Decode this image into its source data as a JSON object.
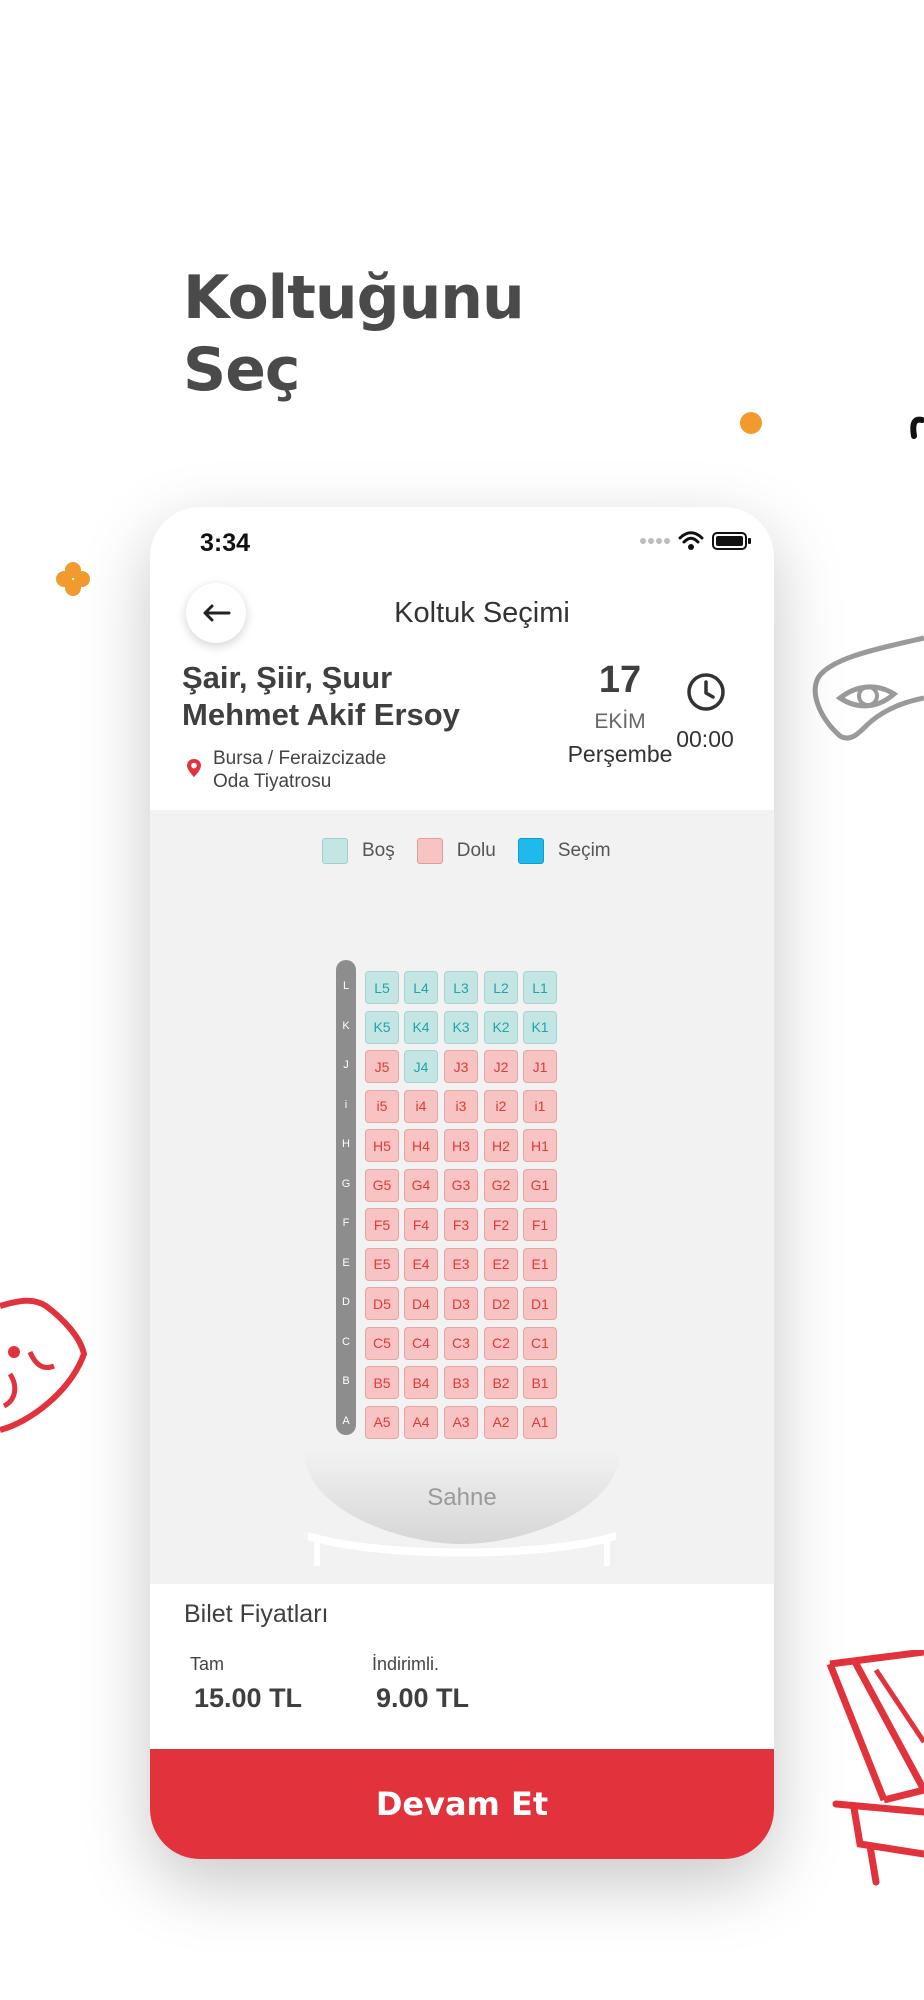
{
  "headline": {
    "line1": "Koltuğunu",
    "line2": "Seç"
  },
  "colors": {
    "accent": "#e2323b",
    "free": "#c3e6e5",
    "taken": "#f7c3c3",
    "selected": "#1fb9ec",
    "decor_orange": "#f39a2f"
  },
  "status_bar": {
    "time": "3:34",
    "icons": [
      "signal-dots-icon",
      "wifi-icon",
      "battery-icon"
    ]
  },
  "nav": {
    "title": "Koltuk Seçimi",
    "back_icon": "arrow-left-icon"
  },
  "event": {
    "title_line1": "Şair, Şiir, Şuur",
    "title_line2": "Mehmet Akif Ersoy",
    "location_line1": "Bursa / Feraizcizade",
    "location_line2": "Oda Tiyatrosu",
    "date_day": "17",
    "date_month": "EKİM",
    "date_weekday": "Perşembe",
    "time": "00:00"
  },
  "legend": [
    {
      "label": "Boş",
      "color": "#c3e6e5"
    },
    {
      "label": "Dolu",
      "color": "#f7c3c3"
    },
    {
      "label": "Seçim",
      "color": "#1fb9ec"
    }
  ],
  "seat_rows": [
    {
      "row": "L",
      "seats": [
        [
          "L5",
          "free"
        ],
        [
          "L4",
          "free"
        ],
        [
          "L3",
          "free"
        ],
        [
          "L2",
          "free"
        ],
        [
          "L1",
          "free"
        ]
      ]
    },
    {
      "row": "K",
      "seats": [
        [
          "K5",
          "free"
        ],
        [
          "K4",
          "free"
        ],
        [
          "K3",
          "free"
        ],
        [
          "K2",
          "free"
        ],
        [
          "K1",
          "free"
        ]
      ]
    },
    {
      "row": "J",
      "seats": [
        [
          "J5",
          "taken"
        ],
        [
          "J4",
          "free"
        ],
        [
          "J3",
          "taken"
        ],
        [
          "J2",
          "taken"
        ],
        [
          "J1",
          "taken"
        ]
      ]
    },
    {
      "row": "i",
      "seats": [
        [
          "i5",
          "taken"
        ],
        [
          "i4",
          "taken"
        ],
        [
          "i3",
          "taken"
        ],
        [
          "i2",
          "taken"
        ],
        [
          "i1",
          "taken"
        ]
      ]
    },
    {
      "row": "H",
      "seats": [
        [
          "H5",
          "taken"
        ],
        [
          "H4",
          "taken"
        ],
        [
          "H3",
          "taken"
        ],
        [
          "H2",
          "taken"
        ],
        [
          "H1",
          "taken"
        ]
      ]
    },
    {
      "row": "G",
      "seats": [
        [
          "G5",
          "taken"
        ],
        [
          "G4",
          "taken"
        ],
        [
          "G3",
          "taken"
        ],
        [
          "G2",
          "taken"
        ],
        [
          "G1",
          "taken"
        ]
      ]
    },
    {
      "row": "F",
      "seats": [
        [
          "F5",
          "taken"
        ],
        [
          "F4",
          "taken"
        ],
        [
          "F3",
          "taken"
        ],
        [
          "F2",
          "taken"
        ],
        [
          "F1",
          "taken"
        ]
      ]
    },
    {
      "row": "E",
      "seats": [
        [
          "E5",
          "taken"
        ],
        [
          "E4",
          "taken"
        ],
        [
          "E3",
          "taken"
        ],
        [
          "E2",
          "taken"
        ],
        [
          "E1",
          "taken"
        ]
      ]
    },
    {
      "row": "D",
      "seats": [
        [
          "D5",
          "taken"
        ],
        [
          "D4",
          "taken"
        ],
        [
          "D3",
          "taken"
        ],
        [
          "D2",
          "taken"
        ],
        [
          "D1",
          "taken"
        ]
      ]
    },
    {
      "row": "C",
      "seats": [
        [
          "C5",
          "taken"
        ],
        [
          "C4",
          "taken"
        ],
        [
          "C3",
          "taken"
        ],
        [
          "C2",
          "taken"
        ],
        [
          "C1",
          "taken"
        ]
      ]
    },
    {
      "row": "B",
      "seats": [
        [
          "B5",
          "taken"
        ],
        [
          "B4",
          "taken"
        ],
        [
          "B3",
          "taken"
        ],
        [
          "B2",
          "taken"
        ],
        [
          "B1",
          "taken"
        ]
      ]
    },
    {
      "row": "A",
      "seats": [
        [
          "A5",
          "taken"
        ],
        [
          "A4",
          "taken"
        ],
        [
          "A3",
          "taken"
        ],
        [
          "A2",
          "taken"
        ],
        [
          "A1",
          "taken"
        ]
      ]
    }
  ],
  "stage": {
    "label": "Sahne"
  },
  "prices": {
    "title": "Bilet Fiyatları",
    "full_label": "Tam",
    "full_value": "15.00 TL",
    "discount_label": "İndirimli.",
    "discount_value": "9.00 TL"
  },
  "continue_button": {
    "label": "Devam Et"
  }
}
